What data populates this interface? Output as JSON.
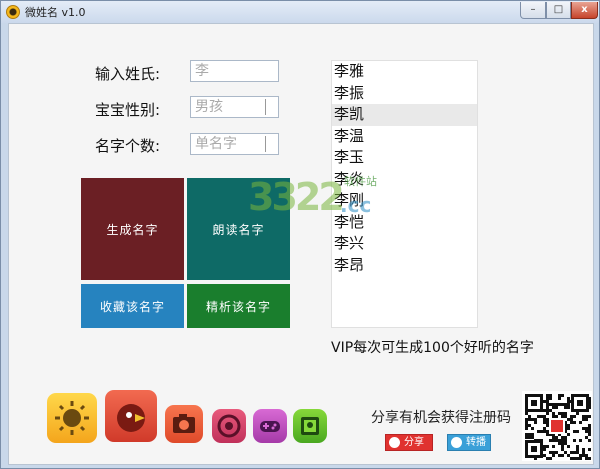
{
  "window": {
    "title": "微姓名 v1.0"
  },
  "controls": {
    "min": "–",
    "max": "□",
    "close": "x"
  },
  "form": {
    "surname_label": "输入姓氏:",
    "surname_placeholder": "李",
    "gender_label": "宝宝性别:",
    "gender_value": "男孩",
    "count_label": "名字个数:",
    "count_value": "单名字"
  },
  "tiles": {
    "generate": "生成名字",
    "read": "朗读名字",
    "favorite": "收藏该名字",
    "analyze": "精析该名字"
  },
  "names": [
    "李雅",
    "李振",
    "李凯",
    "李温",
    "李玉",
    "李炎",
    "李刚",
    "李恺",
    "李兴",
    "李昂"
  ],
  "selected_index": 2,
  "vip_text": "VIP每次可生成100个好听的名字",
  "watermark": {
    "num": "3322",
    "cc": ".cc",
    "site": "软件站"
  },
  "share": {
    "prompt": "分享有机会获得注册码",
    "weibo": "分享",
    "tweibo": "转播"
  },
  "icons": [
    "sun-app-icon",
    "angry-bird-app-icon",
    "camera-app-icon",
    "chrome-app-icon",
    "gamepad-app-icon",
    "contacts-app-icon"
  ],
  "colors": {
    "generate": "#6b1f24",
    "read": "#0e6a66",
    "favorite": "#2683bf",
    "analyze": "#1a7e2d"
  }
}
